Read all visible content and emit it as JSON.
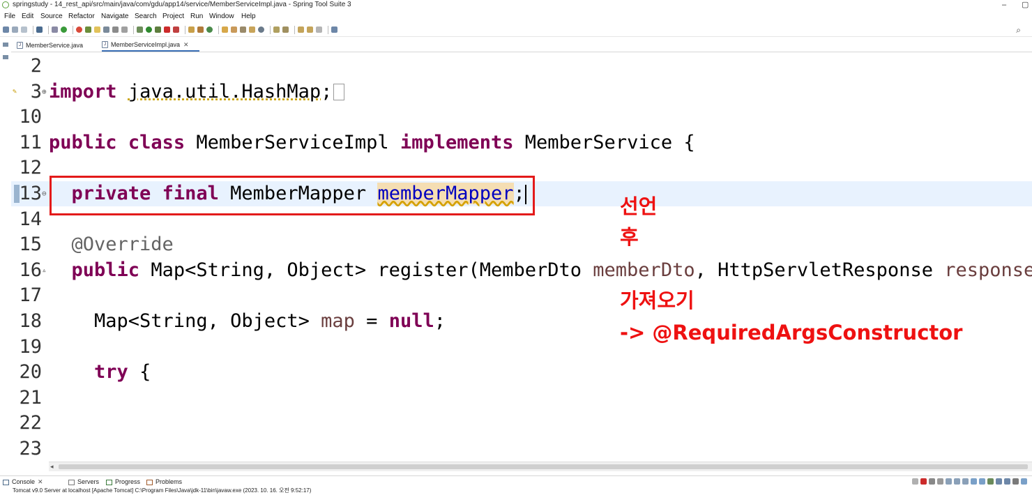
{
  "window": {
    "title": "springstudy - 14_rest_api/src/main/java/com/gdu/app14/service/MemberServiceImpl.java - Spring Tool Suite 3",
    "minimize_glyph": "–",
    "restore_glyph": "▢"
  },
  "menu": [
    "File",
    "Edit",
    "Source",
    "Refactor",
    "Navigate",
    "Search",
    "Project",
    "Run",
    "Window",
    "Help"
  ],
  "tabs": [
    {
      "label": "MemberService.java",
      "active": false
    },
    {
      "label": "MemberServiceImpl.java",
      "active": true,
      "close": "✕"
    }
  ],
  "code": {
    "lines": [
      {
        "n": "2",
        "tokens": []
      },
      {
        "n": "3",
        "fold": "⊕",
        "tokens": [
          [
            "kw",
            "import"
          ],
          [
            "t",
            " "
          ],
          [
            "wavy",
            "java.util.HashMap"
          ],
          [
            "t",
            ";"
          ]
        ],
        "folded": true
      },
      {
        "n": "10",
        "tokens": []
      },
      {
        "n": "11",
        "tokens": [
          [
            "kw",
            "public"
          ],
          [
            "t",
            " "
          ],
          [
            "kw",
            "class"
          ],
          [
            "t",
            " MemberServiceImpl "
          ],
          [
            "kw",
            "implements"
          ],
          [
            "t",
            " MemberService {"
          ]
        ]
      },
      {
        "n": "12",
        "tokens": []
      },
      {
        "n": "13",
        "fold": "⊖",
        "current": true,
        "tokens": [
          [
            "t",
            "  "
          ],
          [
            "kw",
            "private"
          ],
          [
            "t",
            " "
          ],
          [
            "kw",
            "final"
          ],
          [
            "t",
            " MemberMapper "
          ],
          [
            "hl",
            "memberMapper"
          ],
          [
            "t",
            ";"
          ]
        ],
        "caret": true
      },
      {
        "n": "14",
        "tokens": []
      },
      {
        "n": "15",
        "tokens": [
          [
            "t",
            "  "
          ],
          [
            "ann",
            "@Override"
          ]
        ]
      },
      {
        "n": "16",
        "fold": "▵",
        "tokens": [
          [
            "t",
            "  "
          ],
          [
            "kw",
            "public"
          ],
          [
            "t",
            " Map<String, Object> register(MemberDto "
          ],
          [
            "param",
            "memberDto"
          ],
          [
            "t",
            ", HttpServletResponse "
          ],
          [
            "param",
            "response"
          ],
          [
            "t",
            ")"
          ]
        ]
      },
      {
        "n": "17",
        "tokens": []
      },
      {
        "n": "18",
        "tokens": [
          [
            "t",
            "    Map<String, Object> "
          ],
          [
            "param",
            "map"
          ],
          [
            "t",
            " = "
          ],
          [
            "kw",
            "null"
          ],
          [
            "t",
            ";"
          ]
        ]
      },
      {
        "n": "19",
        "tokens": []
      },
      {
        "n": "20",
        "tokens": [
          [
            "t",
            "    "
          ],
          [
            "kw",
            "try"
          ],
          [
            "t",
            " {"
          ]
        ]
      },
      {
        "n": "21",
        "tokens": []
      },
      {
        "n": "22",
        "tokens": []
      },
      {
        "n": "23",
        "tokens": []
      }
    ]
  },
  "annotation": {
    "lines": [
      "선언",
      "후",
      "가져오기",
      "-> @RequiredArgsConstructor"
    ],
    "color": "#ee1111"
  },
  "bottom": {
    "tabs": [
      {
        "label": "Console",
        "close": "✕"
      },
      {
        "label": "Servers"
      },
      {
        "label": "Progress"
      },
      {
        "label": "Problems"
      }
    ],
    "status": "Tomcat v9.0 Server at localhost [Apache Tomcat] C:\\Program Files\\Java\\jdk-11\\bin\\javaw.exe  (2023. 10. 16. 오전 9:52:17)"
  },
  "colors": {
    "keyword": "#7f0055",
    "annotation": "#646464",
    "parameter": "#6a3e3e",
    "field": "#0000c0",
    "current_line": "#e8f2fe",
    "highlight_box": "#e31a1a"
  }
}
